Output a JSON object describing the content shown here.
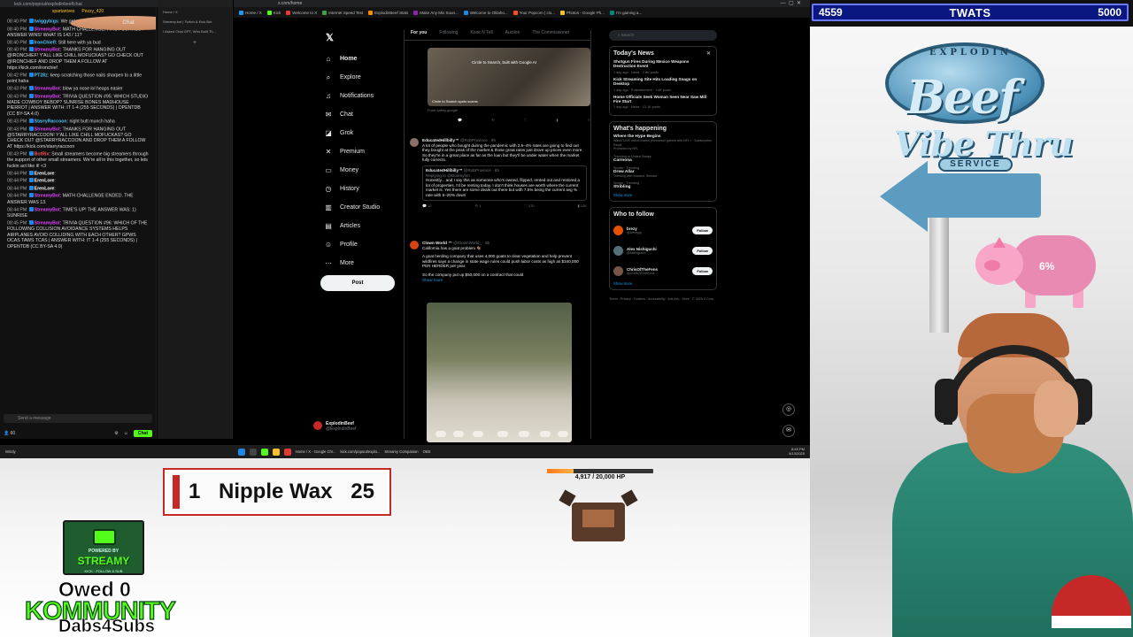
{
  "browser": {
    "left_address": "kick.com/popout/explodinbeef/chat",
    "left_title": "Chat",
    "x_address": "x.com/home",
    "tabs": [
      "Home / X",
      "Kick",
      "Welcome to X",
      "Internet Speed Test",
      "ExplodinBeef Stats",
      "Make Any Mix Soun...",
      "Welcome to Oklaho...",
      "Your Popcorn | clo...",
      "Photos - Google Ph...",
      "I'm gaining a..."
    ],
    "tab_colors": [
      "#1d9bf0",
      "#53fc18",
      "#e53935",
      "#43a047",
      "#fb8c00",
      "#8e24aa",
      "#1e88e5",
      "#f4511e",
      "#fbc02d",
      "#00897b"
    ]
  },
  "chat": {
    "title": "Chat",
    "pinned": [
      "spartanives",
      "Pezzy_420"
    ],
    "messages": [
      {
        "time": "08:40 PM",
        "user": "twiggybigs",
        "color": "#4fc3f7",
        "text": "We get some prizes ?!?"
      },
      {
        "time": "08:40 PM",
        "user": "StreamyBot",
        "color": "#e040fb",
        "text": "MATH CHALLENGE: FIRST CORRECT ANSWER WINS! WHAT IS 143 / 11?"
      },
      {
        "time": "08:40 PM",
        "user": "IronChiefl",
        "color": "#4fc3f7",
        "text": "Still here with ya bud"
      },
      {
        "time": "08:40 PM",
        "user": "StreamyBot",
        "color": "#e040fb",
        "text": "THANKS FOR HANGING OUT @IRONCHIEF! Y'ALL LIKE CHILL MOFUCKAS? GO CHECK OUT @IRONCHIEF AND DROP THEM A FOLLOW AT https://kick.com/ironchief"
      },
      {
        "time": "08:42 PM",
        "user": "PT28z",
        "color": "#4fc3f7",
        "text": "keep scratching those nails sharpen to a little point haha"
      },
      {
        "time": "08:43 PM",
        "user": "StreamyBot",
        "color": "#e040fb",
        "text": "blow ya nose lol heaps easier"
      },
      {
        "time": "08:43 PM",
        "user": "StreamyBot",
        "color": "#e040fb",
        "text": "TRIVIA QUESTION #95: WHICH STUDIO MADE COWBOY BEBOP? SUNRISE BONES MADHOUSE PIERROT | ANSWER WITH: IT 1-4 (255 SECONDS) | OPENTDB (CC BY-SA 4.0)"
      },
      {
        "time": "08:43 PM",
        "user": "StarryRaccoon",
        "color": "#4fc3f7",
        "text": "night butt munch haha"
      },
      {
        "time": "08:43 PM",
        "user": "StreamyBot",
        "color": "#e040fb",
        "text": "THANKS FOR HANGING OUT @STARRYRACCOON! Y'ALL LIKE CHILL MOFUCKAS? GO CHECK OUT @STARRYRACCOON AND DROP THEM A FOLLOW AT https://kick.com/starryraccoon"
      },
      {
        "time": "08:43 PM",
        "user": "BotRix",
        "color": "#ff5252",
        "text": "Small streamers become big streamers through the support of other small streamers. We're all in this together, so lets fuckin act like it! <3"
      },
      {
        "time": "08:44 PM",
        "user": "ErenLore",
        "color": "#ffffff",
        "text": ""
      },
      {
        "time": "08:44 PM",
        "user": "ErenLore",
        "color": "#ffffff",
        "text": ""
      },
      {
        "time": "08:44 PM",
        "user": "ErenLore",
        "color": "#ffffff",
        "text": ""
      },
      {
        "time": "08:44 PM",
        "user": "StreamyBot",
        "color": "#e040fb",
        "text": "MATH CHALLENGE ENDED. THE ANSWER WAS 13."
      },
      {
        "time": "08:44 PM",
        "user": "StreamyBot",
        "color": "#e040fb",
        "text": "TIME'S UP! THE ANSWER WAS: 1) SUNRISE"
      },
      {
        "time": "08:45 PM",
        "user": "StreamyBot",
        "color": "#e040fb",
        "text": "TRIVIA QUESTION #96: WHICH OF THE FOLLOWING COLLISION AVOIDANCE SYSTEMS HELPS AIRPLANES AVOID COLLIDING WITH EACH OTHER? GPWS OCAS TAWS TCAS | ANSWER WITH: IT 1-4 (255 SECONDS) | OPENTDB (CC BY-SA 4.0)"
      }
    ],
    "input_placeholder": "Send a message",
    "viewer_count": "60",
    "send_label": "Chat"
  },
  "sidewin": {
    "tab1": "Home / X",
    "tab2": "Streamy.bot | Twitch & Kick Bot",
    "tab3": "I Asked Chat GPT, Who Built Th..."
  },
  "x": {
    "nav": [
      {
        "label": "Home",
        "icon": "⌂",
        "name": "home-icon"
      },
      {
        "label": "Explore",
        "icon": "⌕",
        "name": "search-icon"
      },
      {
        "label": "Notifications",
        "icon": "♫",
        "name": "bell-icon"
      },
      {
        "label": "Chat",
        "icon": "✉",
        "name": "mail-icon"
      },
      {
        "label": "Grok",
        "icon": "◪",
        "name": "grok-icon"
      },
      {
        "label": "Premium",
        "icon": "✕",
        "name": "premium-icon"
      },
      {
        "label": "Money",
        "icon": "▭",
        "name": "money-icon"
      },
      {
        "label": "History",
        "icon": "◷",
        "name": "history-icon"
      },
      {
        "label": "Creator Studio",
        "icon": "▥",
        "name": "creator-studio-icon"
      },
      {
        "label": "Articles",
        "icon": "▤",
        "name": "articles-icon"
      },
      {
        "label": "Profile",
        "icon": "☺",
        "name": "profile-icon"
      },
      {
        "label": "More",
        "icon": "⋯",
        "name": "more-icon"
      }
    ],
    "post_label": "Post",
    "account_name": "ExplodinBeef",
    "account_handle": "@ExplodinBeef",
    "feed_tabs": [
      "For you",
      "Following",
      "Kook N Tell",
      "Auction",
      "The Commissioner"
    ],
    "media1_caption": "Circle to Search, built with Google AI",
    "media1_sub": "Circle to Search spots scams",
    "media1_meta": "From safety.google",
    "tweet1": {
      "name": "EducatedHillbilly™",
      "handle": "@RobProvince · 8h",
      "text": "A lot of people who bought during the pandemic with 2.5–4% rates are going to find out they bought at the peak of the market & those great rates just drove up prices even more. So they're in a great place as far as the loan but they'll be under water when the market fully corrects.",
      "quote_name": "EducatedHillbilly™",
      "quote_handle": "@RobProvince · 8h",
      "quote_reply": "Replying to @Doomyhm",
      "quote_text": "Honestly... and I say this as someone who's owned, flipped, rented out and restored a lot of properties. I'd be renting today. I don't think houses are worth where the current market is. Yes there are some deals out there but with 7.5% being the current avg % rate with 5–20% down",
      "actions": [
        "12",
        "1",
        "170",
        "12K"
      ]
    },
    "tweet2": {
      "name": "Clown World ™",
      "handle": "@ClownWorld_ · 8h",
      "text": "California has a goat problem 🐐",
      "text2": "A goat herding company that uses 4,000 goats to clear vegetation and help prevent wildfires says a change in state wage rules could push labor costs as high as $340,000 PER HERDER per year.",
      "text3": "So the company put up $50,000 on a contract that could",
      "show_more": "Show more"
    },
    "search_placeholder": "Search",
    "news_title": "Today's News",
    "news": [
      {
        "headline": "Shotgun Fires During Mexico Weapons Destruction Event",
        "meta": "1 day ago · News · 2.8K posts"
      },
      {
        "headline": "Kick Streaming Site Hits Loading Snags on Desktop",
        "meta": "1 day ago · Entertainment · 1.6K posts"
      },
      {
        "headline": "Home Officials Seek Woman Seen Near Saw Mill Fire Start",
        "meta": "1 day ago · News · 12.1K posts"
      }
    ],
    "happening_title": "What's happening",
    "trends": [
      {
        "cat": "",
        "title": "Where the Hype Begins",
        "sub": "Watch LIVE out-of-market preseason games with NFL+ · Subscription Req'd",
        "promo": "Promoted by NFL"
      },
      {
        "cat": "Trending in United States",
        "title": "Carmona",
        "sub": ""
      },
      {
        "cat": "Sports · Trending",
        "title": "Drew Allar",
        "sub": "Trending with Howard, Stewart"
      },
      {
        "cat": "Sports · Trending",
        "title": "Stribling",
        "sub": ""
      }
    ],
    "show_more": "Show more",
    "wtf_title": "Who to follow",
    "follow": [
      {
        "name": "brezy",
        "handle": "@brezyyy",
        "color": "#e65100"
      },
      {
        "name": "Alex Nishiguchi",
        "handle": "@Nishiguchi",
        "color": "#546e7a"
      },
      {
        "name": "ChrisOfTheFens",
        "handle": "@ChrisOfTheFens",
        "color": "#795548"
      }
    ],
    "follow_label": "Follow",
    "footer": "Terms · Privacy · Cookies · Accessibility · Ads info · More · © 2025 X Corp."
  },
  "taskbar": {
    "items": [
      "Home / X - Google Chr...",
      "kick.com/popout/explo...",
      "Streamy Companion",
      "OBS"
    ],
    "time": "8:49 PM",
    "date": "8/13/2025",
    "weather": "Windy"
  },
  "overlay": {
    "twats_left": "4559",
    "twats_title": "TWATS",
    "twats_right": "5000",
    "logo_top": "EXPLODIN",
    "logo_beef": "Beef",
    "logo_vibe": "Vibe Thru",
    "logo_service": "SERVICE",
    "pig_percent": "6%",
    "pig_fraction": 0.06,
    "leaderboard_rank": "1",
    "leaderboard_name": "Nipple Wax",
    "leaderboard_value": "25",
    "hp_text": "4,917 / 20,000 HP",
    "hp_fraction": 0.246,
    "streamy_powered": "POWERED BY",
    "streamy_name": "STREAMY",
    "streamy_kick": "KICK · FOLLOW & SUB",
    "owed": "Owed 0",
    "kommunity": "KOMMUNITY",
    "dabs": "Dabs4Subs",
    "kick_green": "#53fc18"
  }
}
